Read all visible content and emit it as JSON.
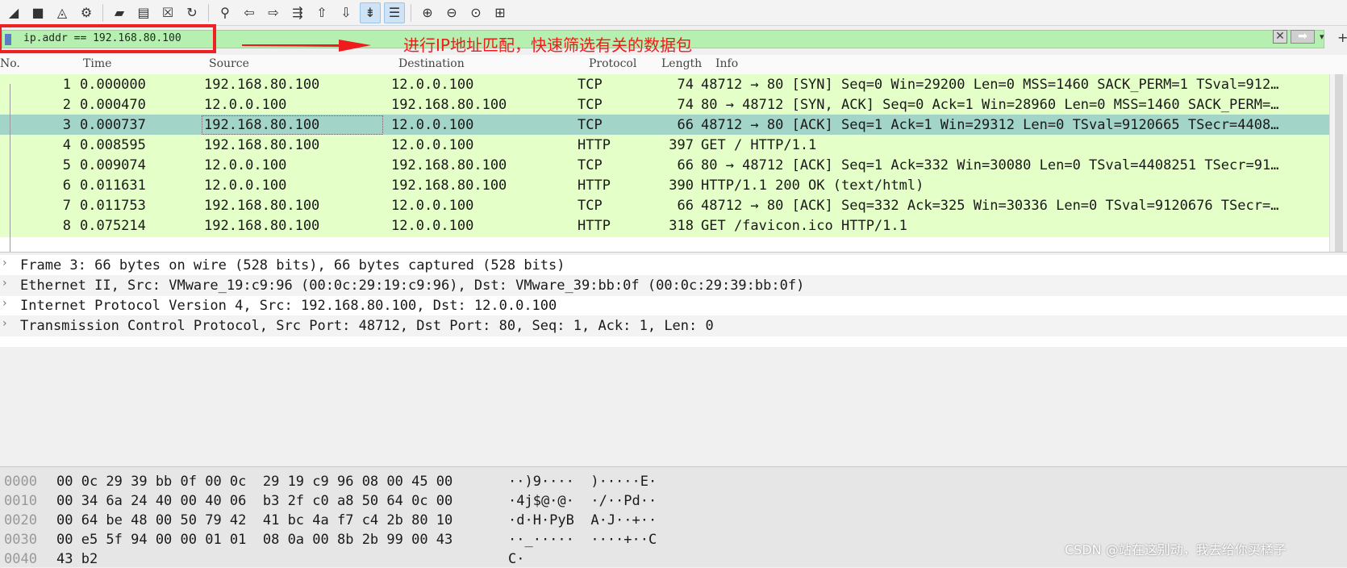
{
  "toolbar": {
    "buttons": [
      {
        "name": "start-capture-icon",
        "glyph": "◢"
      },
      {
        "name": "stop-capture-icon",
        "glyph": "■"
      },
      {
        "name": "restart-capture-icon",
        "glyph": "◬"
      },
      {
        "name": "capture-options-icon",
        "glyph": "⚙"
      },
      {
        "sep": true
      },
      {
        "name": "open-file-icon",
        "glyph": "▰"
      },
      {
        "name": "save-file-icon",
        "glyph": "▤"
      },
      {
        "name": "close-file-icon",
        "glyph": "☒"
      },
      {
        "name": "reload-file-icon",
        "glyph": "↻"
      },
      {
        "sep": true
      },
      {
        "name": "find-packet-icon",
        "glyph": "⚲"
      },
      {
        "name": "go-back-icon",
        "glyph": "⇦"
      },
      {
        "name": "go-forward-icon",
        "glyph": "⇨"
      },
      {
        "name": "go-to-packet-icon",
        "glyph": "⇶"
      },
      {
        "name": "go-first-packet-icon",
        "glyph": "⇧"
      },
      {
        "name": "go-last-packet-icon",
        "glyph": "⇩"
      },
      {
        "name": "auto-scroll-icon",
        "glyph": "⇟",
        "active": true
      },
      {
        "name": "colorize-icon",
        "glyph": "☰",
        "active": true
      },
      {
        "sep": true
      },
      {
        "name": "zoom-in-icon",
        "glyph": "⊕"
      },
      {
        "name": "zoom-out-icon",
        "glyph": "⊖"
      },
      {
        "name": "zoom-normal-icon",
        "glyph": "⊙"
      },
      {
        "name": "resize-columns-icon",
        "glyph": "⊞"
      }
    ]
  },
  "filter": {
    "value": "ip.addr == 192.168.80.100",
    "clear_glyph": "✕",
    "apply_glyph": "➡",
    "dropdown_glyph": "▾",
    "add_glyph": "+"
  },
  "annotation": {
    "text": "进行IP地址匹配，快速筛选有关的数据包",
    "color": "#ee1c1c"
  },
  "packet_list": {
    "columns": [
      "No.",
      "Time",
      "Source",
      "Destination",
      "Protocol",
      "Length",
      "Info"
    ],
    "rows": [
      {
        "no": "1",
        "time": "0.000000",
        "src": "192.168.80.100",
        "dst": "12.0.0.100",
        "proto": "TCP",
        "len": "74",
        "info": "48712 → 80 [SYN] Seq=0 Win=29200 Len=0 MSS=1460 SACK_PERM=1 TSval=912…"
      },
      {
        "no": "2",
        "time": "0.000470",
        "src": "12.0.0.100",
        "dst": "192.168.80.100",
        "proto": "TCP",
        "len": "74",
        "info": "80 → 48712 [SYN, ACK] Seq=0 Ack=1 Win=28960 Len=0 MSS=1460 SACK_PERM=…"
      },
      {
        "no": "3",
        "time": "0.000737",
        "src": "192.168.80.100",
        "dst": "12.0.0.100",
        "proto": "TCP",
        "len": "66",
        "info": "48712 → 80 [ACK] Seq=1 Ack=1 Win=29312 Len=0 TSval=9120665 TSecr=4408…",
        "selected": true
      },
      {
        "no": "4",
        "time": "0.008595",
        "src": "192.168.80.100",
        "dst": "12.0.0.100",
        "proto": "HTTP",
        "len": "397",
        "info": "GET / HTTP/1.1"
      },
      {
        "no": "5",
        "time": "0.009074",
        "src": "12.0.0.100",
        "dst": "192.168.80.100",
        "proto": "TCP",
        "len": "66",
        "info": "80 → 48712 [ACK] Seq=1 Ack=332 Win=30080 Len=0 TSval=4408251 TSecr=91…"
      },
      {
        "no": "6",
        "time": "0.011631",
        "src": "12.0.0.100",
        "dst": "192.168.80.100",
        "proto": "HTTP",
        "len": "390",
        "info": "HTTP/1.1 200 OK  (text/html)"
      },
      {
        "no": "7",
        "time": "0.011753",
        "src": "192.168.80.100",
        "dst": "12.0.0.100",
        "proto": "TCP",
        "len": "66",
        "info": "48712 → 80 [ACK] Seq=332 Ack=325 Win=30336 Len=0 TSval=9120676 TSecr=…"
      },
      {
        "no": "8",
        "time": "0.075214",
        "src": "192.168.80.100",
        "dst": "12.0.0.100",
        "proto": "HTTP",
        "len": "318",
        "info": "GET /favicon.ico HTTP/1.1"
      }
    ],
    "row_color": "#e4ffc7",
    "selected_color": "#a2d4c8"
  },
  "details": [
    "Frame 3: 66 bytes on wire (528 bits), 66 bytes captured (528 bits)",
    "Ethernet II, Src: VMware_19:c9:96 (00:0c:29:19:c9:96), Dst: VMware_39:bb:0f (00:0c:29:39:bb:0f)",
    "Internet Protocol Version 4, Src: 192.168.80.100, Dst: 12.0.0.100",
    "Transmission Control Protocol, Src Port: 48712, Dst Port: 80, Seq: 1, Ack: 1, Len: 0"
  ],
  "bytes": [
    {
      "offset": "0000",
      "hex": "00 0c 29 39 bb 0f 00 0c  29 19 c9 96 08 00 45 00",
      "ascii": "··)9····  )·····E·"
    },
    {
      "offset": "0010",
      "hex": "00 34 6a 24 40 00 40 06  b3 2f c0 a8 50 64 0c 00",
      "ascii": "·4j$@·@·  ·/··Pd··"
    },
    {
      "offset": "0020",
      "hex": "00 64 be 48 00 50 79 42  41 bc 4a f7 c4 2b 80 10",
      "ascii": "·d·H·PyB  A·J··+··"
    },
    {
      "offset": "0030",
      "hex": "00 e5 5f 94 00 00 01 01  08 0a 00 8b 2b 99 00 43",
      "ascii": "··_·····  ····+··C"
    },
    {
      "offset": "0040",
      "hex": "43 b2",
      "ascii": "C·"
    }
  ],
  "watermark": "CSDN @站在这别动，我去给你买橘子"
}
